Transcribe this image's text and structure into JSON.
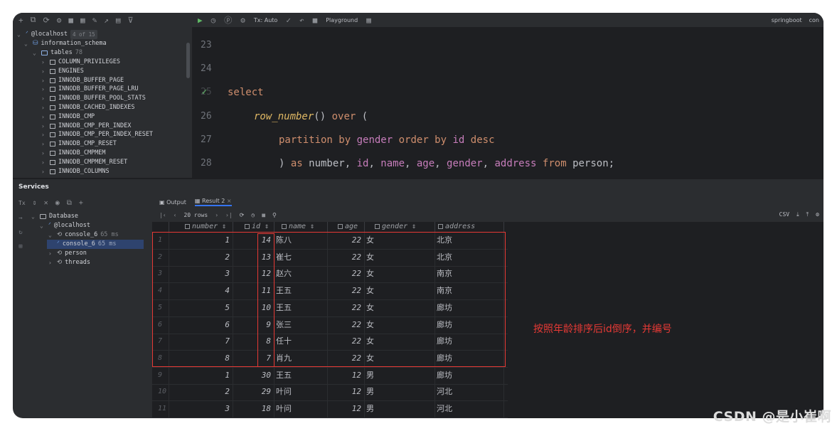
{
  "toolbar": {
    "tx_label": "Tx: Auto",
    "playground_label": "Playground",
    "springboot_label": "springboot",
    "con_label": "con"
  },
  "explorer": {
    "host": "@localhost",
    "host_badge": "4 of 15",
    "schema": "information_schema",
    "tables_label": "tables",
    "tables_count": "78",
    "tables": [
      "COLUMN_PRIVILEGES",
      "ENGINES",
      "INNODB_BUFFER_PAGE",
      "INNODB_BUFFER_PAGE_LRU",
      "INNODB_BUFFER_POOL_STATS",
      "INNODB_CACHED_INDEXES",
      "INNODB_CMP",
      "INNODB_CMP_PER_INDEX",
      "INNODB_CMP_PER_INDEX_RESET",
      "INNODB_CMP_RESET",
      "INNODB_CMPMEM",
      "INNODB_CMPMEM_RESET",
      "INNODB_COLUMNS"
    ]
  },
  "editor": {
    "lines": [
      {
        "n": "23"
      },
      {
        "n": "24"
      },
      {
        "n": "25",
        "kw1": "select"
      },
      {
        "n": "26",
        "fn": "row_number",
        "p1": "() ",
        "kw1": "over",
        "p2": " ("
      },
      {
        "n": "27",
        "kw1": "partition by",
        "c1": "gender",
        "kw2": "order by",
        "c2": "id",
        "kw3": "desc"
      },
      {
        "n": "28",
        "p1": ") ",
        "kw1": "as",
        "p2": " number, ",
        "c1": "id",
        "p3": ", ",
        "c2": "name",
        "p4": ", ",
        "c3": "age",
        "p5": ", ",
        "c4": "gender",
        "p6": ", ",
        "c5": "address",
        "kw2": " from",
        "p7": " person;"
      }
    ]
  },
  "services": {
    "title": "Services",
    "tree": {
      "database": "Database",
      "host": "@localhost",
      "console_group": "console_6",
      "console_group_time": "65 ms",
      "console_item": "console_6",
      "console_item_time": "65 ms",
      "person": "person",
      "threads": "threads"
    }
  },
  "result": {
    "tab_output": "Output",
    "tab_result": "Result 2",
    "rows_label": "20 rows",
    "export_label": "CSV",
    "columns": [
      "number",
      "id",
      "name",
      "age",
      "gender",
      "address"
    ],
    "rows": [
      {
        "r": "1",
        "number": "1",
        "id": "14",
        "name": "陈八",
        "age": "22",
        "gender": "女",
        "address": "北京"
      },
      {
        "r": "2",
        "number": "2",
        "id": "13",
        "name": "崔七",
        "age": "22",
        "gender": "女",
        "address": "北京"
      },
      {
        "r": "3",
        "number": "3",
        "id": "12",
        "name": "赵六",
        "age": "22",
        "gender": "女",
        "address": "南京"
      },
      {
        "r": "4",
        "number": "4",
        "id": "11",
        "name": "王五",
        "age": "22",
        "gender": "女",
        "address": "南京"
      },
      {
        "r": "5",
        "number": "5",
        "id": "10",
        "name": "王五",
        "age": "22",
        "gender": "女",
        "address": "廊坊"
      },
      {
        "r": "6",
        "number": "6",
        "id": "9",
        "name": "张三",
        "age": "22",
        "gender": "女",
        "address": "廊坊"
      },
      {
        "r": "7",
        "number": "7",
        "id": "8",
        "name": "任十",
        "age": "22",
        "gender": "女",
        "address": "廊坊"
      },
      {
        "r": "8",
        "number": "8",
        "id": "7",
        "name": "肖九",
        "age": "22",
        "gender": "女",
        "address": "廊坊"
      },
      {
        "r": "9",
        "number": "1",
        "id": "30",
        "name": "王五",
        "age": "12",
        "gender": "男",
        "address": "廊坊"
      },
      {
        "r": "10",
        "number": "2",
        "id": "29",
        "name": "叶问",
        "age": "12",
        "gender": "男",
        "address": "河北"
      },
      {
        "r": "11",
        "number": "3",
        "id": "18",
        "name": "叶问",
        "age": "12",
        "gender": "男",
        "address": "河北"
      }
    ]
  },
  "annotation": "按照年龄排序后id倒序，并编号",
  "watermark": "CSDN @是小崔啊",
  "colors": {
    "keyword": "#cf8e6d",
    "function": "#e0b864",
    "column": "#c77dbb",
    "annotation_red": "#e53935"
  }
}
